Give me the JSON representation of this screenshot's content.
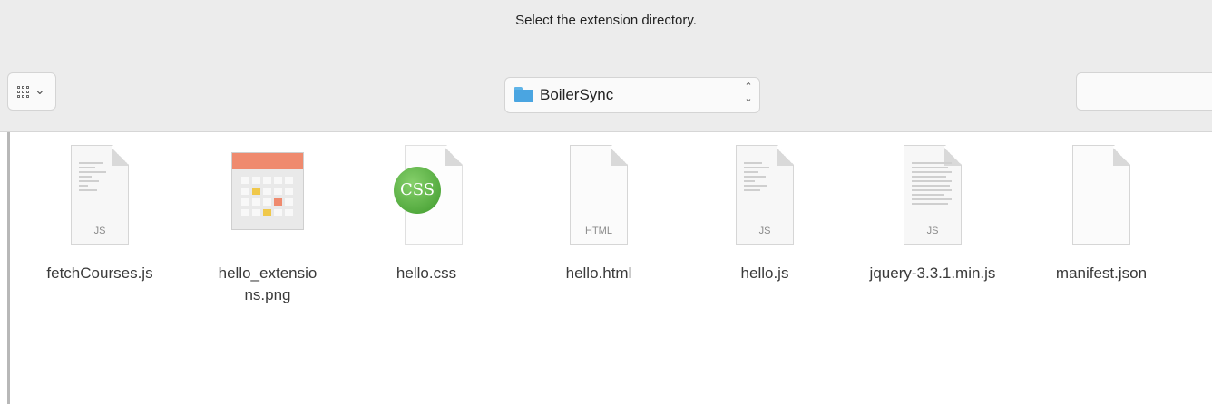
{
  "dialog": {
    "title": "Select the extension directory."
  },
  "toolbar": {
    "view_button_icon": "icon-view-grid-icon",
    "path_popup": {
      "label": "BoilerSync",
      "icon": "folder-icon",
      "chevron_icon": "up-down-chevron-icon"
    },
    "search": {
      "value": ""
    }
  },
  "files": [
    {
      "name": "fetchCourses.js",
      "kind": "js",
      "ext_label": "JS"
    },
    {
      "name": "hello_extensions.png",
      "kind": "png",
      "ext_label": ""
    },
    {
      "name": "hello.css",
      "kind": "css",
      "ext_label": "CSS"
    },
    {
      "name": "hello.html",
      "kind": "html",
      "ext_label": "HTML"
    },
    {
      "name": "hello.js",
      "kind": "js",
      "ext_label": "JS"
    },
    {
      "name": "jquery-3.3.1.min.js",
      "kind": "js",
      "ext_label": "JS"
    },
    {
      "name": "manifest.json",
      "kind": "json",
      "ext_label": ""
    }
  ],
  "partial_next_file_char": "("
}
